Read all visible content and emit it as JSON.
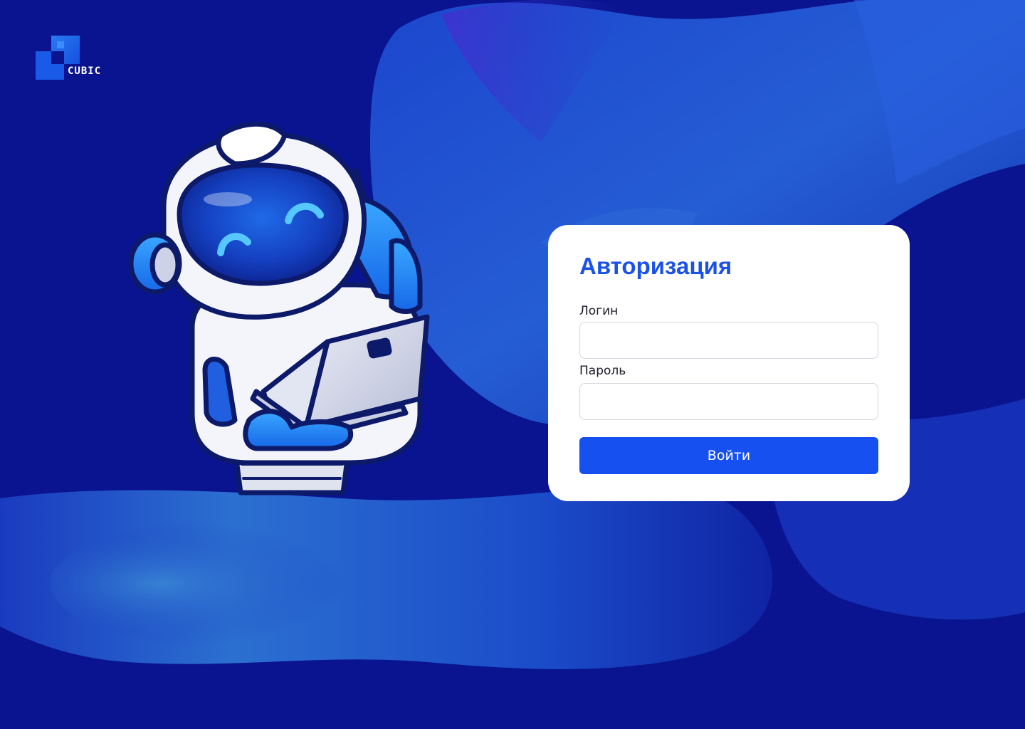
{
  "brand": {
    "name": "CUBIC",
    "logo_icon": "cubic-logo-icon"
  },
  "illustration": {
    "icon": "robot-with-laptop-illustration"
  },
  "auth_form": {
    "title": "Авторизация",
    "login_label": "Логин",
    "login_value": "",
    "password_label": "Пароль",
    "password_value": "",
    "submit_label": "Войти"
  },
  "colors": {
    "background": "#0a1490",
    "accent": "#1650f0",
    "title": "#1a51e8",
    "card": "#ffffff"
  }
}
